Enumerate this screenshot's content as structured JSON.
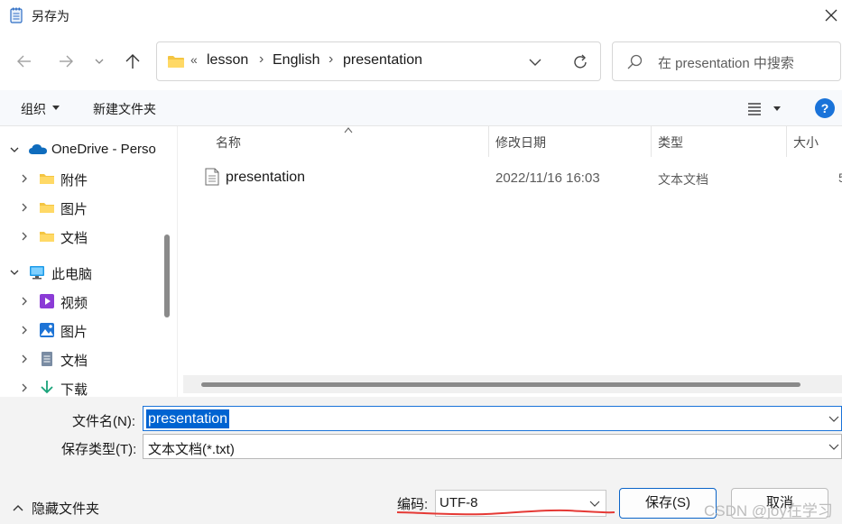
{
  "window": {
    "title": "另存为",
    "close_icon": "close-icon",
    "title_icon": "notepad-icon"
  },
  "nav": {
    "back_icon": "arrow-left-icon",
    "forward_icon": "arrow-right-icon",
    "recent_icon": "chevron-down-icon",
    "up_icon": "arrow-up-icon",
    "address_overflow": "«",
    "breadcrumbs": [
      "lesson",
      "English",
      "presentation"
    ],
    "breadcrumb_separator": "›",
    "search_placeholder": "在 presentation 中搜索"
  },
  "commands": {
    "organize": "组织",
    "new_folder": "新建文件夹",
    "view_icon": "list-view-icon",
    "help": "?"
  },
  "sidebar": {
    "items": [
      {
        "label": "OneDrive - Perso",
        "icon": "onedrive-cloud-icon",
        "expanded": true
      },
      {
        "label": "附件",
        "icon": "folder-icon",
        "expanded": false
      },
      {
        "label": "图片",
        "icon": "folder-icon",
        "expanded": false
      },
      {
        "label": "文档",
        "icon": "folder-icon",
        "expanded": false
      },
      {
        "label": "此电脑",
        "icon": "computer-icon",
        "expanded": true
      },
      {
        "label": "视频",
        "icon": "video-folder-icon",
        "expanded": false
      },
      {
        "label": "图片",
        "icon": "pictures-folder-icon",
        "expanded": false
      },
      {
        "label": "文档",
        "icon": "documents-folder-icon",
        "expanded": false
      },
      {
        "label": "下载",
        "icon": "download-arrow-icon",
        "expanded": false
      }
    ]
  },
  "columns": [
    "名称",
    "修改日期",
    "类型",
    "大小"
  ],
  "files": [
    {
      "name": "presentation",
      "modified": "2022/11/16 16:03",
      "type": "文本文档",
      "size": "5"
    }
  ],
  "form": {
    "filename_label": "文件名(N):",
    "filename_value": "presentation",
    "filetype_label": "保存类型(T):",
    "filetype_value": "文本文档(*.txt)",
    "hide_folders": "隐藏文件夹",
    "encoding_label": "编码:",
    "encoding_value": "UTF-8",
    "save_button": "保存(S)",
    "cancel_button": "取消"
  },
  "watermark": "CSDN @joy在学习",
  "colors": {
    "accent": "#0063d1",
    "annotation_red": "#e53935",
    "folder_yellow": "#f4c542"
  }
}
